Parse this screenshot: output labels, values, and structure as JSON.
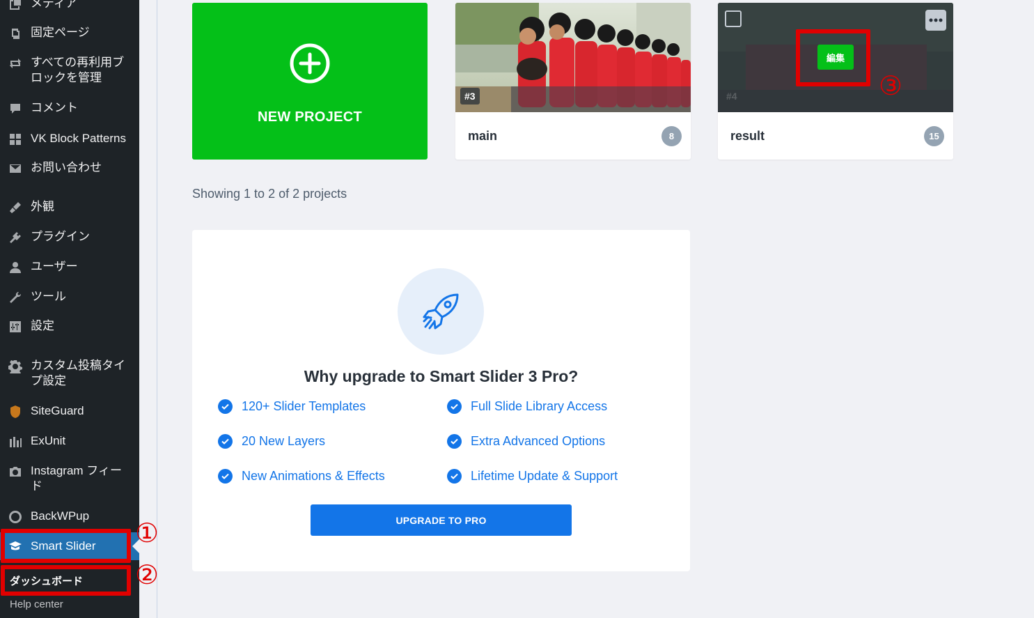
{
  "sidebar": {
    "items": [
      {
        "label": "メディア",
        "icon": "media-icon"
      },
      {
        "label": "固定ページ",
        "icon": "pages-icon"
      },
      {
        "label": "すべての再利用ブロックを管理",
        "icon": "reusable-blocks-icon"
      },
      {
        "label": "コメント",
        "icon": "comment-icon"
      },
      {
        "label": "VK Block Patterns",
        "icon": "block-patterns-icon"
      },
      {
        "label": "お問い合わせ",
        "icon": "mail-icon"
      },
      {
        "label": "外観",
        "icon": "appearance-icon"
      },
      {
        "label": "プラグイン",
        "icon": "plugin-icon"
      },
      {
        "label": "ユーザー",
        "icon": "user-icon"
      },
      {
        "label": "ツール",
        "icon": "tools-icon"
      },
      {
        "label": "設定",
        "icon": "settings-icon"
      },
      {
        "label": "カスタム投稿タイプ設定",
        "icon": "gear-icon"
      },
      {
        "label": "SiteGuard",
        "icon": "siteguard-icon"
      },
      {
        "label": "ExUnit",
        "icon": "exunit-icon"
      },
      {
        "label": "Instagram フィード",
        "icon": "camera-icon"
      },
      {
        "label": "BackWPup",
        "icon": "backwpup-icon"
      },
      {
        "label": "Smart Slider",
        "icon": "smart-slider-icon"
      }
    ],
    "submenu": {
      "dashboard": "ダッシュボード",
      "help": "Help center"
    }
  },
  "annotations": {
    "one": "①",
    "two": "②",
    "three": "③"
  },
  "projects": {
    "new_label": "NEW PROJECT",
    "cards": [
      {
        "name": "main",
        "count": "8",
        "id": "#3"
      },
      {
        "name": "result",
        "count": "15",
        "id": "#4",
        "edit_label": "編集"
      }
    ],
    "showing": "Showing 1 to 2 of 2 projects"
  },
  "upgrade": {
    "title": "Why upgrade to Smart Slider 3 Pro?",
    "features": [
      "120+ Slider Templates",
      "Full Slide Library Access",
      "20 New Layers",
      "Extra Advanced Options",
      "New Animations & Effects",
      "Lifetime Update & Support"
    ],
    "button": "UPGRADE TO PRO"
  },
  "colors": {
    "green": "#04c018",
    "blue": "#1375e8",
    "annotation_red": "#e10000",
    "sidebar_bg": "#1e2327",
    "active_blue": "#2271b1"
  }
}
